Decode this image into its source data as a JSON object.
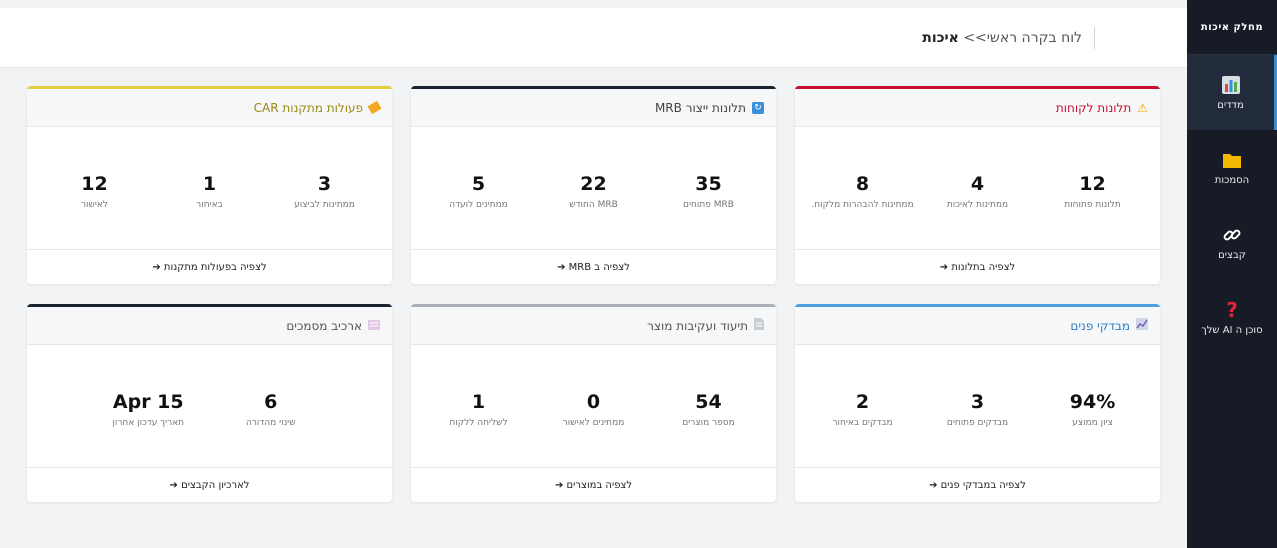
{
  "sidebar": {
    "title": "מחלק איכות",
    "items": [
      {
        "label": "מדדים",
        "icon": "chart-icon",
        "active": true
      },
      {
        "label": "הסמכות",
        "icon": "folder-icon",
        "active": false
      },
      {
        "label": "קבצים",
        "icon": "link-icon",
        "active": false
      },
      {
        "label": "סוכן ה AI שלך",
        "icon": "question-icon",
        "active": false
      }
    ]
  },
  "header": {
    "breadcrumb_base": "לוח בקרה ראשי>>",
    "breadcrumb_current": "איכות"
  },
  "cards": [
    {
      "title": "תלונות לקוחות",
      "icon": "warning-icon",
      "accent": "#c8102e",
      "title_color": "#c8102e",
      "stats": [
        {
          "value": "12",
          "label": "תלונות פתוחות"
        },
        {
          "value": "4",
          "label": "ממתינות לאיכות"
        },
        {
          "value": "8",
          "label": "ממתינות להבהרות מלקוח."
        }
      ],
      "link": "לצפיה בתלונות ➔"
    },
    {
      "title": "תלונות ייצור MRB",
      "icon": "refresh-icon",
      "accent": "#1b2230",
      "title_color": "#444",
      "stats": [
        {
          "value": "35",
          "label": "MRB פתוחים"
        },
        {
          "value": "22",
          "label": "MRB החודש"
        },
        {
          "value": "5",
          "label": "ממתינים לועדה"
        }
      ],
      "link": "לצפיה ב MRB ➔"
    },
    {
      "title": "פעולות מתקנות CAR",
      "icon": "tag-icon",
      "accent": "#e2cf3e",
      "title_color": "#9a8a10",
      "stats": [
        {
          "value": "3",
          "label": "ממתינות לביצוע"
        },
        {
          "value": "1",
          "label": "באיחור"
        },
        {
          "value": "12",
          "label": "לאישור"
        }
      ],
      "link": "לצפיה בפעולות מתקנות ➔"
    },
    {
      "title": "מבדקי פנים",
      "icon": "trend-icon",
      "accent": "#4a9fdf",
      "title_color": "#2f7fc4",
      "stats": [
        {
          "value": "94%",
          "label": "ציון ממוצע"
        },
        {
          "value": "3",
          "label": "מבדקים פתוחים"
        },
        {
          "value": "2",
          "label": "מבדקים באיחור"
        }
      ],
      "link": "לצפיה במבדקי פנים ➔"
    },
    {
      "title": "תיעוד ועקיבות מוצר",
      "icon": "document-icon",
      "accent": "#aab0b6",
      "title_color": "#555",
      "stats": [
        {
          "value": "54",
          "label": "מספר מוצרים"
        },
        {
          "value": "0",
          "label": "ממתינים לאישור"
        },
        {
          "value": "1",
          "label": "לשליחה ללקוח"
        }
      ],
      "link": "לצפיה במוצרים ➔"
    },
    {
      "title": "ארכיב מסמכים",
      "icon": "archive-icon",
      "accent": "#1b2230",
      "title_color": "#555",
      "stats": [
        {
          "value": "6",
          "label": "שינוי מהדורה"
        },
        {
          "value": "Apr 15",
          "label": "תאריך עדכון אחרון"
        }
      ],
      "link": "לארכיון הקבצים ➔"
    }
  ]
}
